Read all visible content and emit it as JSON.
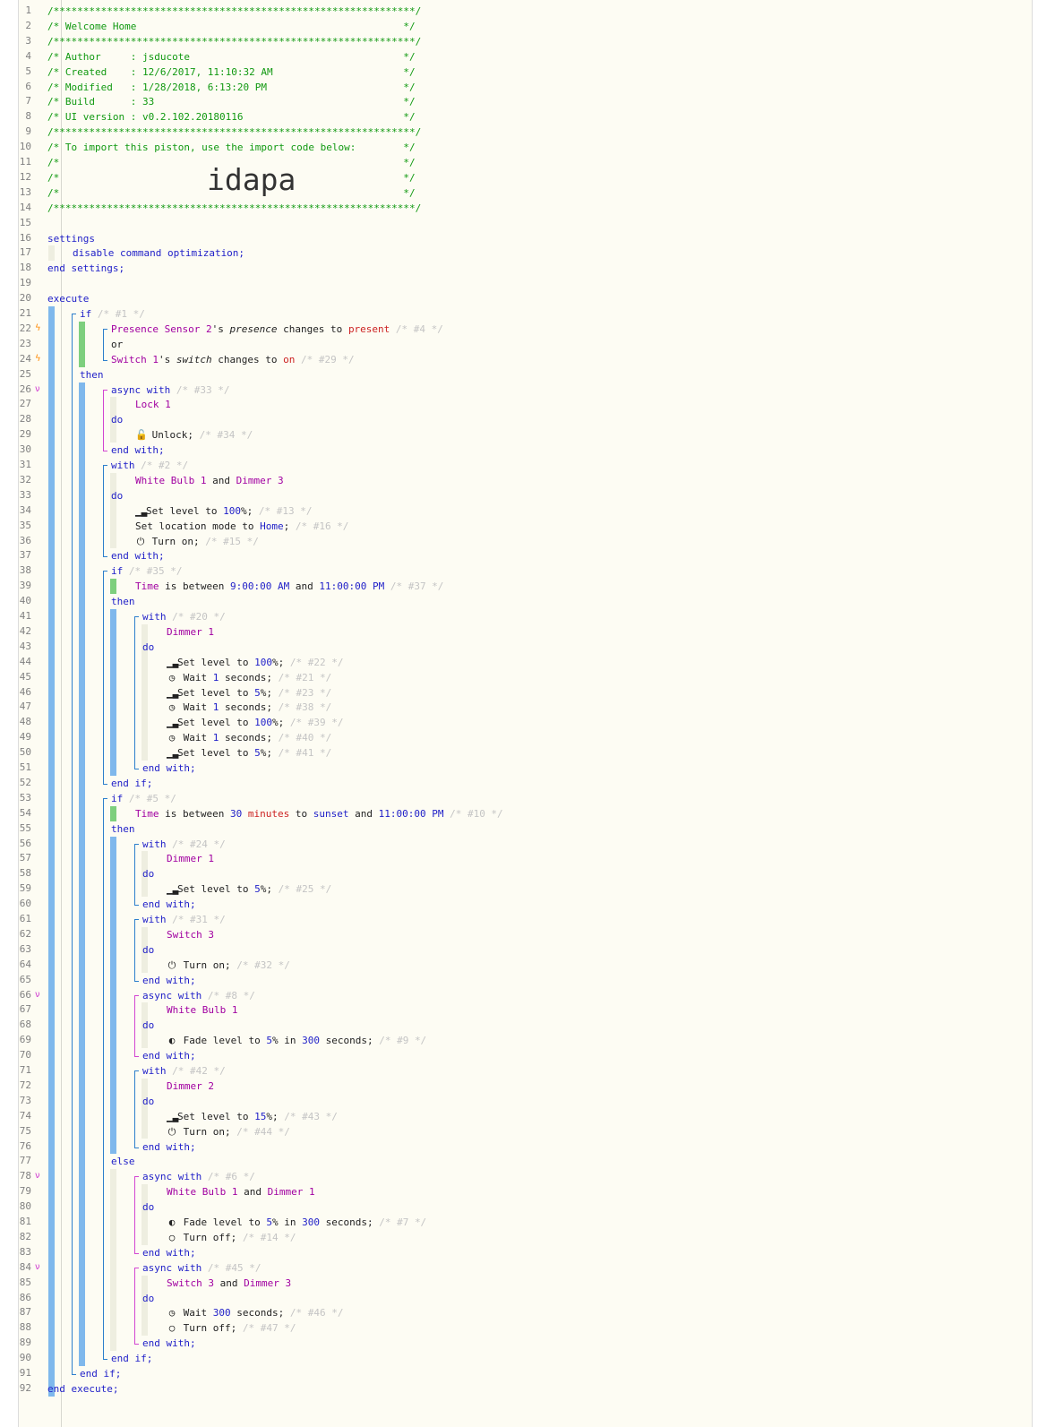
{
  "header": {
    "title_label": "Welcome Home",
    "author": "jsducote",
    "created": "12/6/2017, 11:10:32 AM",
    "modified": "1/28/2018, 6:13:20 PM",
    "build": "33",
    "ui_version": "v0.2.102.20180116",
    "import_text": "To import this piston, use the import code below:",
    "import_code": "idapa"
  },
  "line_numbers": [
    "1",
    "2",
    "3",
    "4",
    "5",
    "6",
    "7",
    "8",
    "9",
    "10",
    "11",
    "12",
    "13",
    "14",
    "15",
    "16",
    "17",
    "18",
    "19",
    "20",
    "21",
    "22",
    "23",
    "24",
    "25",
    "26",
    "27",
    "28",
    "29",
    "30",
    "31",
    "32",
    "33",
    "34",
    "35",
    "36",
    "37",
    "38",
    "39",
    "40",
    "41",
    "42",
    "43",
    "44",
    "45",
    "46",
    "47",
    "48",
    "49",
    "50",
    "51",
    "52",
    "53",
    "54",
    "55",
    "56",
    "57",
    "58",
    "59",
    "60",
    "61",
    "62",
    "63",
    "64",
    "65",
    "66",
    "67",
    "68",
    "69",
    "70",
    "71",
    "72",
    "73",
    "74",
    "75",
    "76",
    "77",
    "78",
    "79",
    "80",
    "81",
    "82",
    "83",
    "84",
    "85",
    "86",
    "87",
    "88",
    "89",
    "90",
    "91",
    "92"
  ],
  "icons": {
    "trigger": "bolt-icon",
    "async": "async-icon",
    "lock": "lock-icon",
    "level": "signal-bars-icon",
    "power": "power-icon",
    "wait": "clock-icon",
    "fade": "toggle-icon",
    "off": "circle-icon"
  },
  "colors": {
    "keyword": "#1e1ec8",
    "device": "#a100a1",
    "comment": "#119911",
    "trigger": "#ff8800",
    "async": "#d245d2",
    "value_red": "#cc2222",
    "bar_blue": "#7fb8ec",
    "bar_green": "#7ecf7e"
  }
}
